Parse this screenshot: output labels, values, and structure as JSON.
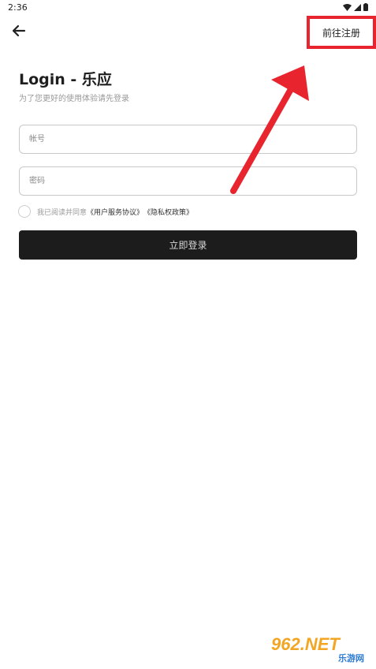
{
  "status_bar": {
    "time": "2:36"
  },
  "header": {
    "back_icon": "arrow-left-icon",
    "register_label": "前往注册",
    "highlight_color": "#e8242e"
  },
  "login": {
    "title": "Login - 乐应",
    "subtitle": "为了您更好的使用体验请先登录",
    "account_placeholder": "帐号",
    "password_placeholder": "密码",
    "agreement_prefix": "我已阅读并同意",
    "user_agreement_link": "《用户服务协议》",
    "privacy_link": "《隐私权政策》",
    "submit_label": "立即登录"
  },
  "watermark": {
    "brand": "962.NET",
    "site_name": "乐游网"
  }
}
